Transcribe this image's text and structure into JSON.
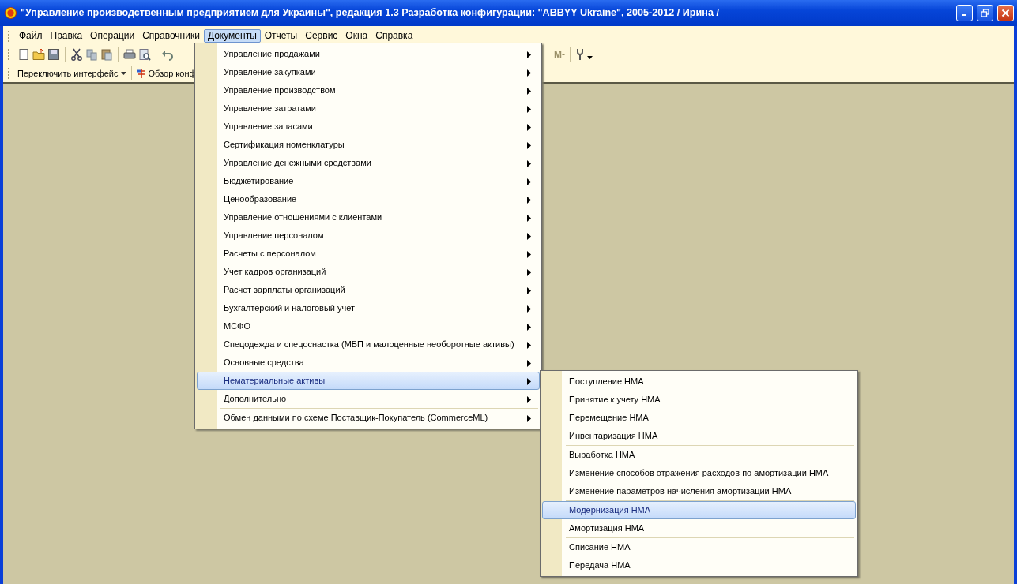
{
  "window": {
    "title": "\"Управление производственным предприятием для Украины\", редакция 1.3 Разработка конфигурации: \"ABBYY Ukraine\", 2005-2012 / Ирина /"
  },
  "menubar": [
    {
      "label": "Файл",
      "selected": false
    },
    {
      "label": "Правка",
      "selected": false
    },
    {
      "label": "Операции",
      "selected": false
    },
    {
      "label": "Справочники",
      "selected": false
    },
    {
      "label": "Документы",
      "selected": true
    },
    {
      "label": "Отчеты",
      "selected": false
    },
    {
      "label": "Сервис",
      "selected": false
    },
    {
      "label": "Окна",
      "selected": false
    },
    {
      "label": "Справка",
      "selected": false
    }
  ],
  "toolbar": {
    "calc_button": "М-"
  },
  "toolbar2": [
    {
      "label": "Переключить интерфейс",
      "kind": "dropdown"
    },
    {
      "label": "Обзор конф",
      "kind": "tree"
    }
  ],
  "menu": [
    {
      "label": "Управление продажами",
      "selected": false,
      "separator_before": false
    },
    {
      "label": "Управление закупками",
      "selected": false,
      "separator_before": false
    },
    {
      "label": "Управление производством",
      "selected": false,
      "separator_before": false
    },
    {
      "label": "Управление затратами",
      "selected": false,
      "separator_before": false
    },
    {
      "label": "Управление запасами",
      "selected": false,
      "separator_before": false
    },
    {
      "label": "Сертификация номенклатуры",
      "selected": false,
      "separator_before": false
    },
    {
      "label": "Управление денежными средствами",
      "selected": false,
      "separator_before": false
    },
    {
      "label": "Бюджетирование",
      "selected": false,
      "separator_before": false
    },
    {
      "label": "Ценообразование",
      "selected": false,
      "separator_before": false
    },
    {
      "label": "Управление отношениями с клиентами",
      "selected": false,
      "separator_before": false
    },
    {
      "label": "Управление персоналом",
      "selected": false,
      "separator_before": false
    },
    {
      "label": "Расчеты с персоналом",
      "selected": false,
      "separator_before": false
    },
    {
      "label": "Учет кадров организаций",
      "selected": false,
      "separator_before": false
    },
    {
      "label": "Расчет зарплаты организаций",
      "selected": false,
      "separator_before": false
    },
    {
      "label": "Бухгалтерский и налоговый учет",
      "selected": false,
      "separator_before": false
    },
    {
      "label": "МСФО",
      "selected": false,
      "separator_before": false
    },
    {
      "label": "Спецодежда и спецоснастка (МБП и малоценные необоротные активы)",
      "selected": false,
      "separator_before": false
    },
    {
      "label": "Основные средства",
      "selected": false,
      "separator_before": false
    },
    {
      "label": "Нематериальные активы",
      "selected": true,
      "separator_before": false
    },
    {
      "label": "Дополнительно",
      "selected": false,
      "separator_before": false
    },
    {
      "label": "Обмен данными по схеме Поставщик-Покупатель (CommerceML)",
      "selected": false,
      "separator_before": true
    }
  ],
  "submenu": [
    {
      "label": "Поступление НМА",
      "selected": false,
      "separator_before": false
    },
    {
      "label": "Принятие к учету НМА",
      "selected": false,
      "separator_before": false
    },
    {
      "label": "Перемещение НМА",
      "selected": false,
      "separator_before": false
    },
    {
      "label": "Инвентаризация НМА",
      "selected": false,
      "separator_before": false
    },
    {
      "label": "Выработка НМА",
      "selected": false,
      "separator_before": true
    },
    {
      "label": "Изменение способов отражения расходов по амортизации НМА",
      "selected": false,
      "separator_before": false
    },
    {
      "label": "Изменение параметров начисления амортизации НМА",
      "selected": false,
      "separator_before": false
    },
    {
      "label": "Модернизация НМА",
      "selected": true,
      "separator_before": true
    },
    {
      "label": "Амортизация НМА",
      "selected": false,
      "separator_before": false
    },
    {
      "label": "Списание НМА",
      "selected": false,
      "separator_before": true
    },
    {
      "label": "Передача НМА",
      "selected": false,
      "separator_before": false
    }
  ]
}
